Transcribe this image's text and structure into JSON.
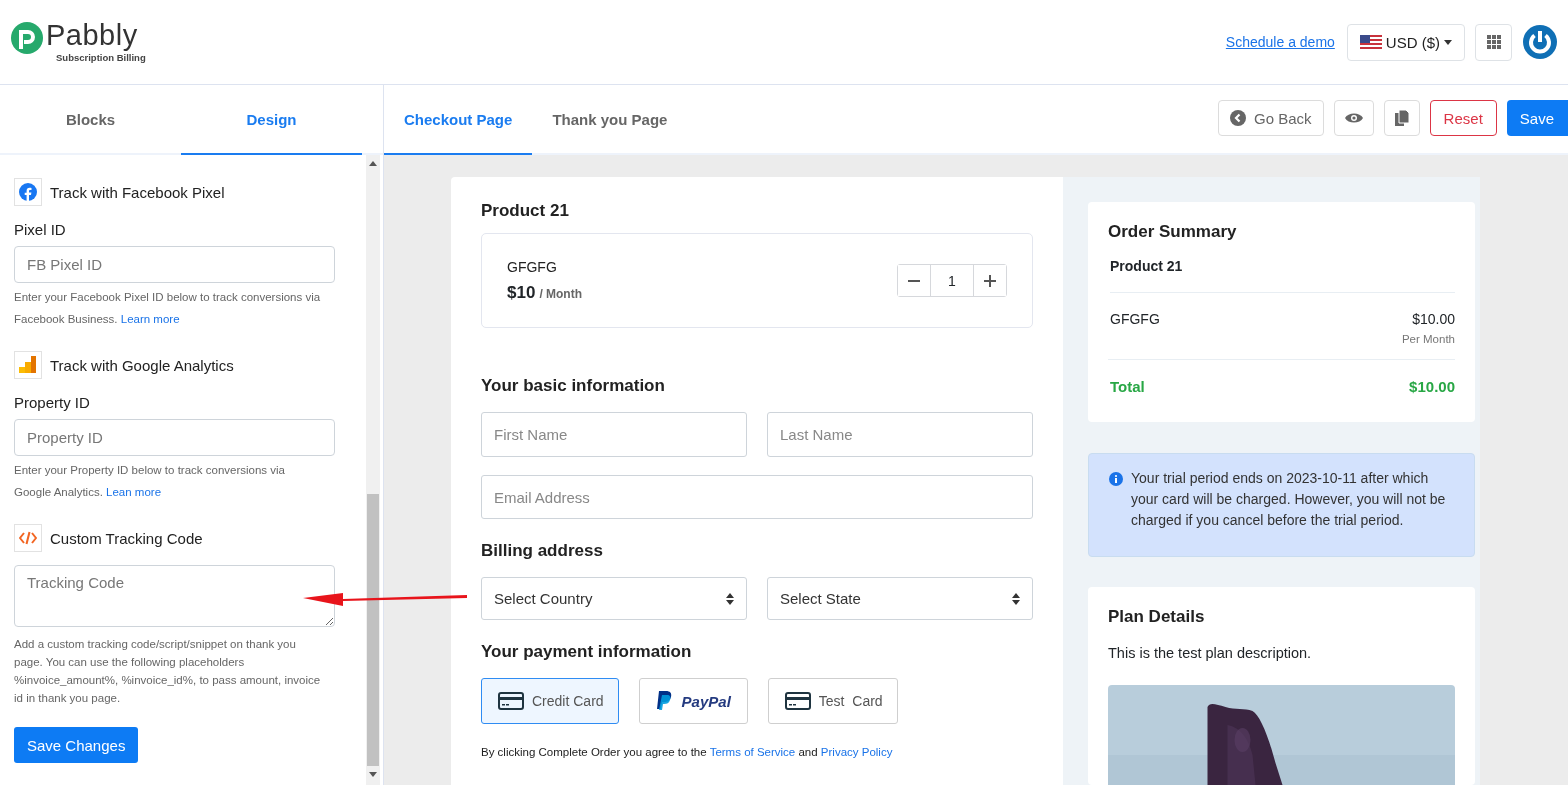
{
  "header": {
    "logo": {
      "name": "Pabbly",
      "tagline": "Subscription Billing"
    },
    "schedule_link": "Schedule a demo",
    "currency": "USD ($)"
  },
  "sidebar": {
    "tabs": [
      {
        "label": "Blocks",
        "selected": false
      },
      {
        "label": "Design",
        "selected": true
      }
    ],
    "sections": [
      {
        "kind": "facebook",
        "title": "Track with Facebook Pixel",
        "field_label": "Pixel ID",
        "placeholder": "FB Pixel ID",
        "help": "Enter your Facebook Pixel ID below to track conversions via Facebook Business.",
        "link": "Learn more"
      },
      {
        "kind": "analytics",
        "title": "Track with Google Analytics",
        "field_label": "Property ID",
        "placeholder": "Property ID",
        "help": "Enter your Property ID below to track conversions via Google Analytics.",
        "link": "Lean more"
      },
      {
        "kind": "code",
        "title": "Custom Tracking Code",
        "placeholder": "Tracking Code",
        "help": "Add a custom tracking code/script/snippet on thank you page. You can use the following placeholders %invoice_amount%, %invoice_id%, to pass amount, invoice id in thank you page."
      }
    ],
    "save_button": "Save Changes"
  },
  "editor": {
    "tabs": [
      {
        "label": "Checkout Page",
        "selected": true
      },
      {
        "label": "Thank you Page",
        "selected": false
      }
    ],
    "back_button": "Go Back",
    "reset_button": "Reset",
    "save_button": "Save"
  },
  "checkout": {
    "product": {
      "title": "Product 21",
      "item": "GFGFG",
      "price": "$10",
      "period": "/ Month",
      "quantity": "1"
    },
    "basic_info": {
      "title": "Your basic information",
      "fields": [
        {
          "placeholder": "First Name"
        },
        {
          "placeholder": "Last Name"
        },
        {
          "placeholder": "Email Address"
        }
      ]
    },
    "billing": {
      "title": "Billing address",
      "selects": [
        {
          "placeholder": "Select Country"
        },
        {
          "placeholder": "Select State"
        }
      ]
    },
    "payment": {
      "title": "Your payment information",
      "methods": [
        {
          "kind": "card",
          "label": "Credit Card",
          "selected": true
        },
        {
          "kind": "paypal",
          "label": "PayPal",
          "selected": false
        },
        {
          "kind": "card",
          "label": "Test  Card",
          "selected": false
        }
      ]
    },
    "terms": {
      "text": "By clicking Complete Order you agree to the",
      "terms_link": "Terms of Service",
      "joiner": "and",
      "privacy_link": "Privacy Policy"
    },
    "order_summary": {
      "title": "Order Summary",
      "product": "Product 21",
      "item": "GFGFG",
      "amount": "$10.00",
      "period": "Per Month",
      "total_label": "Total",
      "total": "$10.00"
    },
    "notice": "Your trial period ends on 2023-10-11 after which your card will be charged. However, you will not be charged if you cancel before the trial period.",
    "plan": {
      "title": "Plan Details",
      "description": "This is the test plan description."
    }
  }
}
